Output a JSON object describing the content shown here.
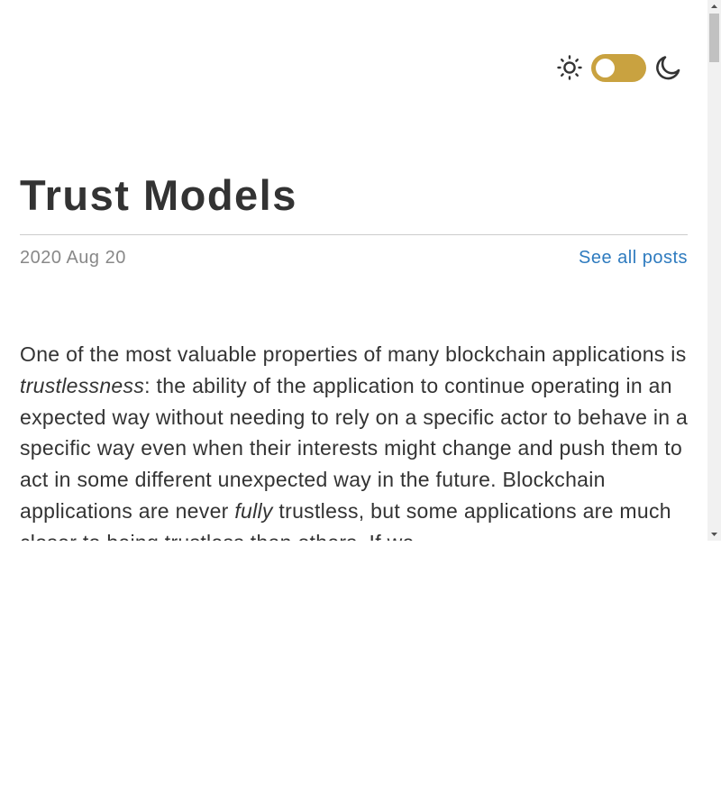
{
  "theme_switch": {
    "light_icon": "sun-icon",
    "dark_icon": "moon-icon",
    "accent_color": "#c9a240"
  },
  "post": {
    "title": "Trust Models",
    "date": "2020 Aug 20",
    "all_posts_link": "See all posts",
    "body": {
      "s1": "One of the most valuable properties of many blockchain applications is ",
      "e1": "trustlessness",
      "s2": ": the ability of the application to continue operating in an expected way without needing to rely on a specific actor to behave in a specific way even when their interests might change and push them to act in some different unexpected way in the future. Blockchain applications are never ",
      "e2": "fully",
      "s3": " trustless, but some applications are much closer to being trustless than others. If we"
    }
  },
  "colors": {
    "text": "#333333",
    "muted": "#888888",
    "link": "#2e7bbf"
  }
}
